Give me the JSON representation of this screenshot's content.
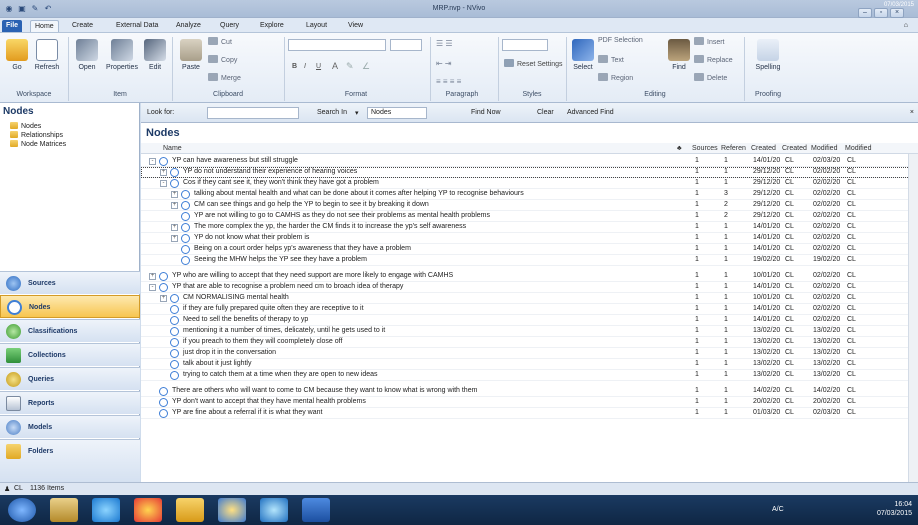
{
  "window": {
    "title": "MRP.nvp - NVivo",
    "date_top": "07/03/2015"
  },
  "tabs": [
    "File",
    "Home",
    "Create",
    "External Data",
    "Analyze",
    "Query",
    "Explore",
    "Layout",
    "View"
  ],
  "ribbon": {
    "workspace": {
      "go": "Go",
      "refresh": "Refresh",
      "label": "Workspace"
    },
    "item": {
      "open": "Open",
      "properties": "Properties",
      "edit": "Edit",
      "label": "Item"
    },
    "clipboard": {
      "paste": "Paste",
      "cut": "Cut",
      "copy": "Copy",
      "merge": "Merge",
      "label": "Clipboard"
    },
    "format": {
      "b": "B",
      "i": "I",
      "u": "U",
      "font_color": "A",
      "label": "Format"
    },
    "paragraph": {
      "label": "Paragraph"
    },
    "styles": {
      "reset": "Reset Settings",
      "label": "Styles"
    },
    "editing": {
      "select": "Select",
      "pdf_selection": "PDF Selection",
      "text": "Text",
      "region": "Region",
      "find": "Find",
      "insert": "Insert",
      "replace": "Replace",
      "delete": "Delete",
      "label": "Editing"
    },
    "proofing": {
      "spelling": "Spelling",
      "label": "Proofing"
    }
  },
  "left": {
    "title": "Nodes",
    "items": [
      "Nodes",
      "Relationships",
      "Node Matrices"
    ],
    "nav": [
      "Sources",
      "Nodes",
      "Classifications",
      "Collections",
      "Queries",
      "Reports",
      "Models",
      "Folders"
    ]
  },
  "lookbar": {
    "look_for": "Look for:",
    "search_in": "Search In",
    "scope": "Nodes",
    "find_now": "Find Now",
    "clear": "Clear",
    "advanced": "Advanced Find"
  },
  "main": {
    "heading": "Nodes",
    "columns": [
      "Name",
      "Sources",
      "Referen",
      "Created",
      "Created",
      "Modified",
      "Modified"
    ],
    "rows": [
      {
        "lvl": 0,
        "exp": "-",
        "name": "YP can have awareness but still struggle",
        "src": "1",
        "ref": "1",
        "cr": "14/01/20",
        "cb": "CL",
        "md": "02/03/20",
        "mb": "CL"
      },
      {
        "lvl": 1,
        "exp": "+",
        "name": "YP do not understand their experience of hearing voices",
        "src": "1",
        "ref": "1",
        "cr": "29/12/20",
        "cb": "CL",
        "md": "02/02/20",
        "mb": "CL",
        "sel": true
      },
      {
        "lvl": 1,
        "exp": "-",
        "name": "Cos if they cant see it, they won't think they have got a problem",
        "src": "1",
        "ref": "1",
        "cr": "29/12/20",
        "cb": "CL",
        "md": "02/02/20",
        "mb": "CL"
      },
      {
        "lvl": 2,
        "exp": "+",
        "name": "talking about mental health and what can be done about it comes after helping YP to recognise behaviours",
        "src": "1",
        "ref": "3",
        "cr": "29/12/20",
        "cb": "CL",
        "md": "02/02/20",
        "mb": "CL"
      },
      {
        "lvl": 2,
        "exp": "+",
        "name": "CM can see things and go help the YP to begin to see it by breaking it down",
        "src": "1",
        "ref": "2",
        "cr": "29/12/20",
        "cb": "CL",
        "md": "02/02/20",
        "mb": "CL"
      },
      {
        "lvl": 2,
        "exp": "",
        "name": "YP are not willing to go to CAMHS as they do not see their problems as mental health problems",
        "src": "1",
        "ref": "2",
        "cr": "29/12/20",
        "cb": "CL",
        "md": "02/02/20",
        "mb": "CL"
      },
      {
        "lvl": 2,
        "exp": "+",
        "name": "The more complex the yp, the harder the CM finds it to increase the yp's self awareness",
        "src": "1",
        "ref": "1",
        "cr": "14/01/20",
        "cb": "CL",
        "md": "02/02/20",
        "mb": "CL"
      },
      {
        "lvl": 2,
        "exp": "+",
        "name": "YP do not know what their problem is",
        "src": "1",
        "ref": "1",
        "cr": "14/01/20",
        "cb": "CL",
        "md": "02/02/20",
        "mb": "CL"
      },
      {
        "lvl": 2,
        "exp": "",
        "name": "Being on a court order helps yp's awareness that they have a problem",
        "src": "1",
        "ref": "1",
        "cr": "14/01/20",
        "cb": "CL",
        "md": "02/02/20",
        "mb": "CL"
      },
      {
        "lvl": 2,
        "exp": "",
        "name": "Seeing the MHW helps the YP see they have a problem",
        "src": "1",
        "ref": "1",
        "cr": "19/02/20",
        "cb": "CL",
        "md": "19/02/20",
        "mb": "CL"
      },
      {
        "gap": true
      },
      {
        "lvl": 0,
        "exp": "+",
        "name": "YP who are willing to accept that they need support are more likely to engage with CAMHS",
        "src": "1",
        "ref": "1",
        "cr": "10/01/20",
        "cb": "CL",
        "md": "02/02/20",
        "mb": "CL"
      },
      {
        "lvl": 0,
        "exp": "-",
        "name": "YP that are able to recognise a problem need cm to broach idea of therapy",
        "src": "1",
        "ref": "1",
        "cr": "14/01/20",
        "cb": "CL",
        "md": "02/02/20",
        "mb": "CL"
      },
      {
        "lvl": 1,
        "exp": "+",
        "name": "CM NORMALISING mental health",
        "src": "1",
        "ref": "1",
        "cr": "10/01/20",
        "cb": "CL",
        "md": "02/02/20",
        "mb": "CL"
      },
      {
        "lvl": 1,
        "exp": "",
        "name": "if they are fully prepared quite often they are receptive to it",
        "src": "1",
        "ref": "1",
        "cr": "14/01/20",
        "cb": "CL",
        "md": "02/02/20",
        "mb": "CL"
      },
      {
        "lvl": 1,
        "exp": "",
        "name": "Need to sell the benefits of therapy to yp",
        "src": "1",
        "ref": "1",
        "cr": "14/01/20",
        "cb": "CL",
        "md": "02/02/20",
        "mb": "CL"
      },
      {
        "lvl": 1,
        "exp": "",
        "name": "mentioning it a number of times, delicately, until he gets used to it",
        "src": "1",
        "ref": "1",
        "cr": "13/02/20",
        "cb": "CL",
        "md": "13/02/20",
        "mb": "CL"
      },
      {
        "lvl": 1,
        "exp": "",
        "name": "if you preach to them they will coompletely close off",
        "src": "1",
        "ref": "1",
        "cr": "13/02/20",
        "cb": "CL",
        "md": "13/02/20",
        "mb": "CL"
      },
      {
        "lvl": 1,
        "exp": "",
        "name": "just drop it in the conversation",
        "src": "1",
        "ref": "1",
        "cr": "13/02/20",
        "cb": "CL",
        "md": "13/02/20",
        "mb": "CL"
      },
      {
        "lvl": 1,
        "exp": "",
        "name": "talk about it just lightly",
        "src": "1",
        "ref": "1",
        "cr": "13/02/20",
        "cb": "CL",
        "md": "13/02/20",
        "mb": "CL"
      },
      {
        "lvl": 1,
        "exp": "",
        "name": "trying to catch them at a time when they are open to new ideas",
        "src": "1",
        "ref": "1",
        "cr": "13/02/20",
        "cb": "CL",
        "md": "13/02/20",
        "mb": "CL"
      },
      {
        "gap": true
      },
      {
        "lvl": 0,
        "exp": "",
        "name": "There are others who will want to come to CM because they want to know what is wrong with them",
        "src": "1",
        "ref": "1",
        "cr": "14/02/20",
        "cb": "CL",
        "md": "14/02/20",
        "mb": "CL"
      },
      {
        "lvl": 0,
        "exp": "",
        "name": "YP don't want to accept that they have mental health problems",
        "src": "1",
        "ref": "1",
        "cr": "20/02/20",
        "cb": "CL",
        "md": "20/02/20",
        "mb": "CL"
      },
      {
        "lvl": 0,
        "exp": "",
        "name": "YP are fine about a referral if it is what they want",
        "src": "1",
        "ref": "1",
        "cr": "01/03/20",
        "cb": "CL",
        "md": "02/03/20",
        "mb": "CL"
      }
    ]
  },
  "status": {
    "user": "CL",
    "items": "1136 Items"
  },
  "taskbar": {
    "lang": "A/C",
    "time": "16:04",
    "date": "07/03/2015"
  },
  "colors": {
    "accent": "#2a62b3",
    "nav_active": "#f7c550",
    "node_icon": "#3f7fd6"
  }
}
